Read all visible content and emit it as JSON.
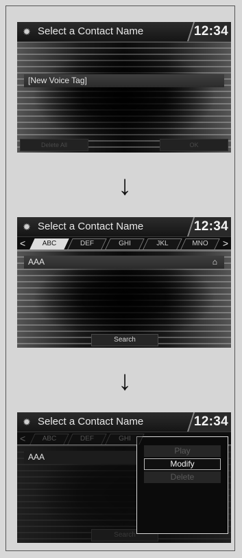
{
  "screen1": {
    "title": "Select a Contact Name",
    "clock": "12:34",
    "list_item": "[New Voice Tag]",
    "buttons": {
      "delete_all": "Delete All",
      "ok": "OK"
    }
  },
  "screen2": {
    "title": "Select a Contact Name",
    "clock": "12:34",
    "tabs": [
      "ABC",
      "DEF",
      "GHI",
      "JKL",
      "MNO"
    ],
    "active_tab": "ABC",
    "list_item": "AAA",
    "home_icon": "home-icon",
    "search_label": "Search"
  },
  "screen3": {
    "title": "Select a Contact Name",
    "clock": "12:34",
    "tabs": [
      "ABC",
      "DEF",
      "GHI"
    ],
    "list_item": "AAA",
    "search_label": "Search",
    "popup": {
      "items": [
        "Play",
        "Modify",
        "Delete"
      ],
      "selected": "Modify"
    }
  },
  "arrows": [
    "↓",
    "↓"
  ],
  "icons": {
    "settings": "gear-icon",
    "left": "chevron-left-icon",
    "right": "chevron-right-icon"
  }
}
